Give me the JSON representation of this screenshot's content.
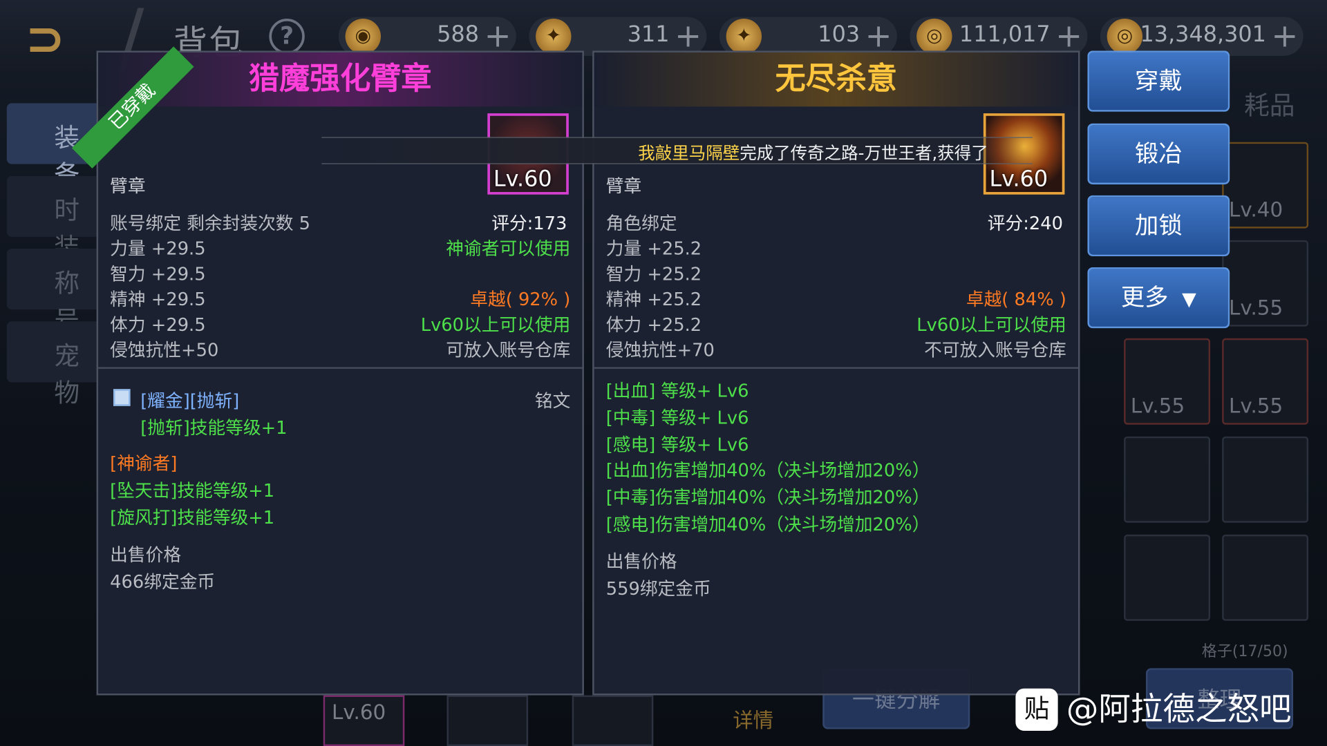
{
  "topbar": {
    "title": "背包",
    "help": "?",
    "currencies": [
      {
        "icon": "coin-icon",
        "value": "588"
      },
      {
        "icon": "scroll-icon",
        "value": "311"
      },
      {
        "icon": "scroll-icon",
        "value": "103"
      },
      {
        "icon": "gold-icon",
        "value": "111,017"
      },
      {
        "icon": "gold-icon",
        "value": "13,348,301"
      }
    ]
  },
  "left_tabs": [
    "装备",
    "时装",
    "称号",
    "宠物"
  ],
  "broadcast": {
    "name": "我敲里马隔壁",
    "text": "完成了传奇之路-万世王者,获得了"
  },
  "item_left": {
    "badge": "已穿戴",
    "name": "猎魔强化臂章",
    "level": "Lv.60",
    "type": "臂章",
    "bind": "账号绑定 剩余封装次数 5",
    "score": "评分:173",
    "stats": [
      "力量 +29.5",
      "智力 +29.5",
      "精神 +29.5",
      "体力 +29.5",
      "侵蚀抗性+50"
    ],
    "right_info": [
      "神谕者可以使用",
      "",
      "卓越( 92% )",
      "Lv60以上可以使用",
      "可放入账号仓库"
    ],
    "inscription_label": "[耀金][抛斩]",
    "inscription_tag": "铭文",
    "inscription_effect": "[抛斩]技能等级+1",
    "class_label": "[神谕者]",
    "class_effects": [
      "[坠天击]技能等级+1",
      "[旋风打]技能等级+1"
    ],
    "sell_label": "出售价格",
    "sell_value": "466绑定金币"
  },
  "item_right": {
    "name": "无尽杀意",
    "level": "Lv.60",
    "type": "臂章",
    "bind": "角色绑定",
    "score": "评分:240",
    "stats": [
      "力量 +25.2",
      "智力 +25.2",
      "精神 +25.2",
      "体力 +25.2",
      "侵蚀抗性+70"
    ],
    "right_info": [
      "",
      "",
      "卓越( 84% )",
      "Lv60以上可以使用",
      "不可放入账号仓库"
    ],
    "effects": [
      "[出血] 等级+ Lv6",
      "[中毒] 等级+ Lv6",
      "[感电] 等级+ Lv6",
      "[出血]伤害增加40%（决斗场增加20%）",
      "[中毒]伤害增加40%（决斗场增加20%）",
      "[感电]伤害增加40%（决斗场增加20%）"
    ],
    "sell_label": "出售价格",
    "sell_value": "559绑定金币"
  },
  "actions": {
    "wear": "穿戴",
    "forge": "锻冶",
    "lock": "加锁",
    "more": "更多",
    "more_arrow": "▼"
  },
  "right_tab_partial": "耗品",
  "grid_levels": [
    "Lv.40",
    "Lv.55",
    "Lv.55",
    "Lv.55"
  ],
  "grid_count": "格子(17/50)",
  "bottom": {
    "slot_level": "Lv.60",
    "detail": "详情",
    "disassemble": "一键分解",
    "sort": "整理"
  },
  "watermark": {
    "icon": "贴",
    "text": "@阿拉德之怒吧"
  }
}
